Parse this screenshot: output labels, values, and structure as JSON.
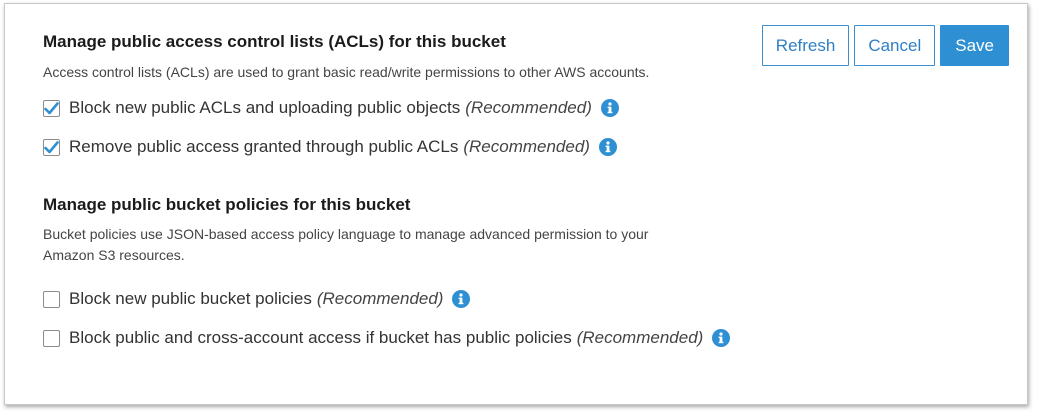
{
  "toolbar": {
    "refresh_label": "Refresh",
    "cancel_label": "Cancel",
    "save_label": "Save"
  },
  "acl_section": {
    "title": "Manage public access control lists (ACLs) for this bucket",
    "description": "Access control lists (ACLs) are used to grant basic read/write permissions to other AWS accounts.",
    "options": [
      {
        "label": "Block new public ACLs and uploading public objects",
        "note": "(Recommended)",
        "checked": true
      },
      {
        "label": "Remove public access granted through public ACLs",
        "note": "(Recommended)",
        "checked": true
      }
    ]
  },
  "policy_section": {
    "title": "Manage public bucket policies for this bucket",
    "description_line1": "Bucket policies use JSON-based access policy language to manage advanced permission to your",
    "description_line2": "Amazon S3 resources.",
    "options": [
      {
        "label": "Block new public bucket policies",
        "note": "(Recommended)",
        "checked": false
      },
      {
        "label": "Block public and cross-account access if bucket has public policies",
        "note": "(Recommended)",
        "checked": false
      }
    ]
  },
  "colors": {
    "accent": "#2f8fd3",
    "border": "#c8c8c8"
  },
  "icons": {
    "checkmark": "check-icon",
    "info": "info-icon"
  }
}
